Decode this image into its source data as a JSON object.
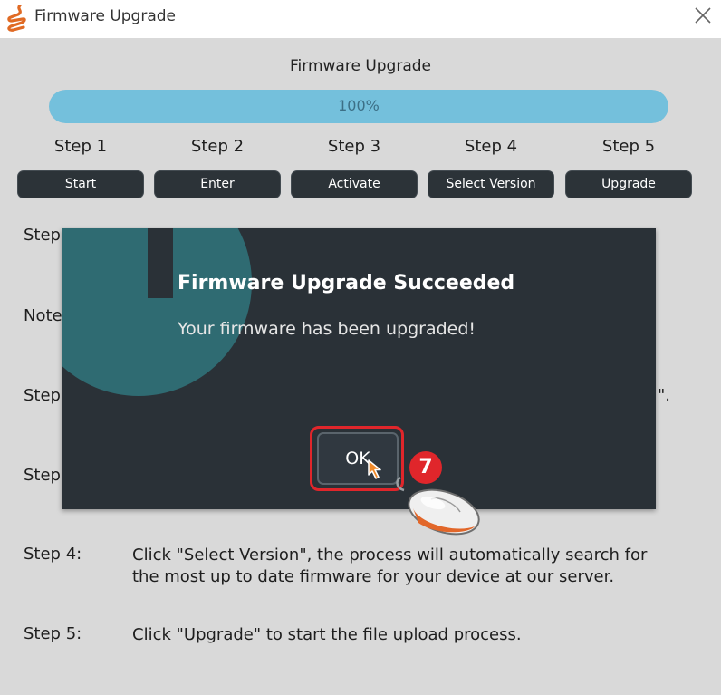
{
  "window": {
    "title": "Firmware Upgrade"
  },
  "header": {
    "title": "Firmware Upgrade"
  },
  "progress": {
    "value": 1.0,
    "label": "100%"
  },
  "steps": [
    {
      "label": "Step 1",
      "button": "Start"
    },
    {
      "label": "Step 2",
      "button": "Enter"
    },
    {
      "label": "Step 3",
      "button": "Activate"
    },
    {
      "label": "Step 4",
      "button": "Select Version"
    },
    {
      "label": "Step 5",
      "button": "Upgrade"
    }
  ],
  "instructions": {
    "partial_step_a": "Step",
    "partial_note": "Note",
    "partial_step_b": "Step",
    "partial_step_c": "Step",
    "partial_suffix": "\".",
    "step4_label": "Step 4:",
    "step4_text": "Click \"Select Version\", the process will automatically search for the most up to date firmware for your device at our server.",
    "step5_label": "Step 5:",
    "step5_text": "Click \"Upgrade\" to start the file upload process."
  },
  "dialog": {
    "title": "Firmware Upgrade Succeeded",
    "message": "Your firmware has been upgraded!",
    "ok_label": "OK"
  },
  "annotation": {
    "badge": "7"
  },
  "icons": {
    "app": "flame-logo-icon",
    "close": "close-icon",
    "info": "info-icon",
    "cursor": "cursor-icon",
    "mouse": "mouse-icon"
  },
  "colors": {
    "accent": "#74c0dc",
    "dialog_bg": "#2a3137",
    "highlight": "#e0262b"
  }
}
